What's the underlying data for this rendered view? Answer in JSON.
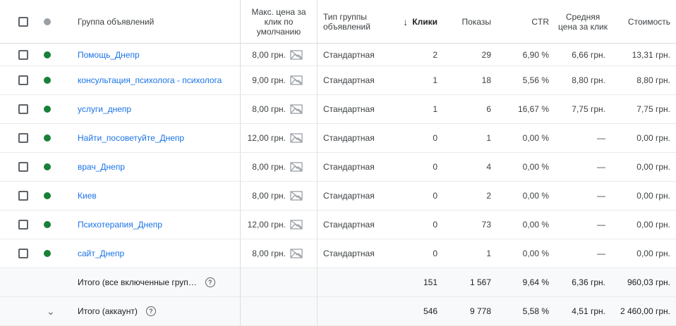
{
  "header": {
    "name": "Группа объявлений",
    "bid": "Макс. цена за клик по умолчанию",
    "type": "Тип группы объявлений",
    "clicks": "Клики",
    "impressions": "Показы",
    "ctr": "CTR",
    "avg_cpc": "Средняя цена за клик",
    "cost": "Стоимость"
  },
  "rows": [
    {
      "name": "Помощь_Днепр",
      "bid": "8,00 грн.",
      "type": "Стандартная",
      "clicks": "2",
      "impressions": "29",
      "ctr": "6,90 %",
      "avg_cpc": "6,66 грн.",
      "cost": "13,31 грн."
    },
    {
      "name": "консультация_психолога - психолога",
      "bid": "9,00 грн.",
      "type": "Стандартная",
      "clicks": "1",
      "impressions": "18",
      "ctr": "5,56 %",
      "avg_cpc": "8,80 грн.",
      "cost": "8,80 грн."
    },
    {
      "name": "услуги_днепр",
      "bid": "8,00 грн.",
      "type": "Стандартная",
      "clicks": "1",
      "impressions": "6",
      "ctr": "16,67 %",
      "avg_cpc": "7,75 грн.",
      "cost": "7,75 грн."
    },
    {
      "name": "Найти_посоветуйте_Днепр",
      "bid": "12,00 грн.",
      "type": "Стандартная",
      "clicks": "0",
      "impressions": "1",
      "ctr": "0,00 %",
      "avg_cpc": "—",
      "cost": "0,00 грн."
    },
    {
      "name": "врач_Днепр",
      "bid": "8,00 грн.",
      "type": "Стандартная",
      "clicks": "0",
      "impressions": "4",
      "ctr": "0,00 %",
      "avg_cpc": "—",
      "cost": "0,00 грн."
    },
    {
      "name": "Киев",
      "bid": "8,00 грн.",
      "type": "Стандартная",
      "clicks": "0",
      "impressions": "2",
      "ctr": "0,00 %",
      "avg_cpc": "—",
      "cost": "0,00 грн."
    },
    {
      "name": "Психотерапия_Днепр",
      "bid": "12,00 грн.",
      "type": "Стандартная",
      "clicks": "0",
      "impressions": "73",
      "ctr": "0,00 %",
      "avg_cpc": "—",
      "cost": "0,00 грн."
    },
    {
      "name": "сайт_Днепр",
      "bid": "8,00 грн.",
      "type": "Стандартная",
      "clicks": "0",
      "impressions": "1",
      "ctr": "0,00 %",
      "avg_cpc": "—",
      "cost": "0,00 грн."
    }
  ],
  "totals": [
    {
      "label": "Итого (все включенные груп…",
      "clicks": "151",
      "impressions": "1 567",
      "ctr": "9,64 %",
      "avg_cpc": "6,36 грн.",
      "cost": "960,03 грн."
    },
    {
      "label": "Итого (аккаунт)",
      "clicks": "546",
      "impressions": "9 778",
      "ctr": "5,58 %",
      "avg_cpc": "4,51 грн.",
      "cost": "2 460,00 грн."
    }
  ],
  "icons": {
    "status": "status-dot-icon",
    "image": "no-image-icon",
    "sort": "arrow-down-icon",
    "help": "help-icon",
    "expand": "chevron-down-icon"
  },
  "colors": {
    "link": "#1a73e8",
    "enabled": "#188038",
    "header_dot": "#9aa0a6"
  }
}
